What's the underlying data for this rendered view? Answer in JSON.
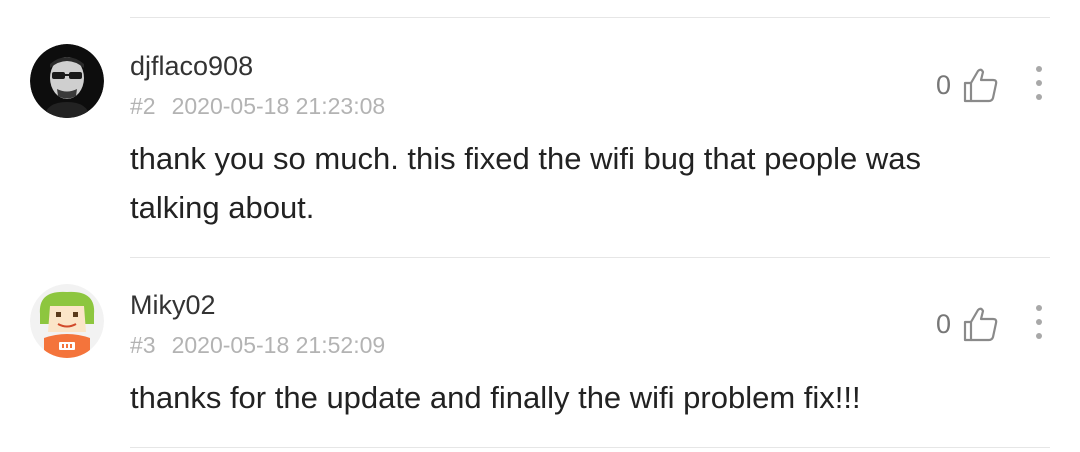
{
  "comments": [
    {
      "username": "djflaco908",
      "floor": "#2",
      "timestamp": "2020-05-18 21:23:08",
      "likes": "0",
      "text": "thank you so much. this fixed the wifi bug that people was talking about.",
      "avatar_icon": "man-with-sunglasses-avatar",
      "like_icon": "thumbs-up-icon",
      "more_icon": "more-vertical-icon"
    },
    {
      "username": "Miky02",
      "floor": "#3",
      "timestamp": "2020-05-18 21:52:09",
      "likes": "0",
      "text": "thanks for the update and finally the wifi problem fix!!!",
      "avatar_icon": "mi-bunny-avatar",
      "like_icon": "thumbs-up-icon",
      "more_icon": "more-vertical-icon"
    }
  ],
  "colors": {
    "divider": "#e6e6e6",
    "meta_text": "#b3b3b3",
    "body_text": "#222222",
    "mi_orange": "#f4743b",
    "mi_green": "#8dc63f"
  }
}
